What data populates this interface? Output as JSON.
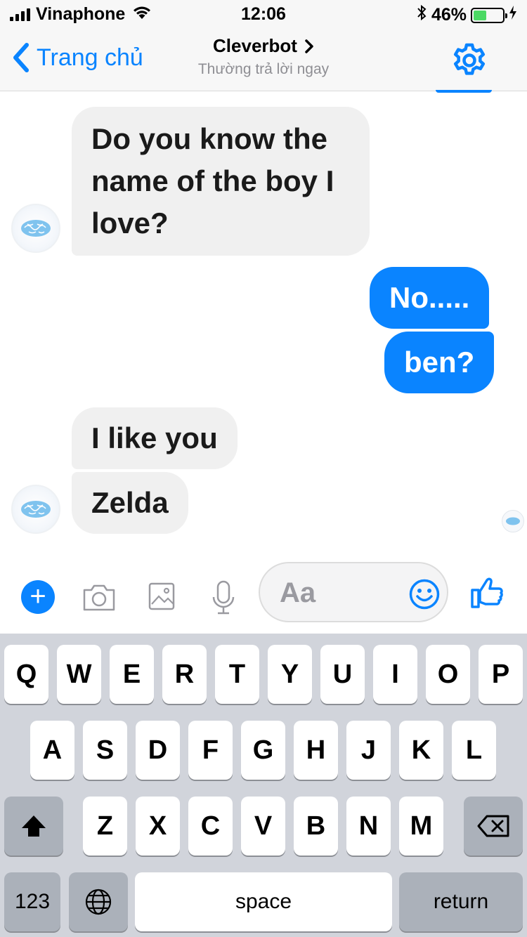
{
  "status_bar": {
    "carrier": "Vinaphone",
    "time": "12:06",
    "battery_percent": "46%",
    "battery_level": 0.46
  },
  "nav": {
    "back_label": "Trang chủ",
    "title": "Cleverbot",
    "subtitle": "Thường trả lời ngay",
    "accent": "#0a84ff"
  },
  "messages": [
    {
      "from": "bot",
      "text": "Do you know the name of the boy I love?"
    },
    {
      "from": "me",
      "text": "No....."
    },
    {
      "from": "me",
      "text": "ben?"
    },
    {
      "from": "bot",
      "text": "I like you"
    },
    {
      "from": "bot",
      "text": "Zelda"
    }
  ],
  "composer": {
    "placeholder": "Aa",
    "icons": [
      "plus-icon",
      "camera-icon",
      "image-icon",
      "microphone-icon",
      "emoji-icon",
      "thumbs-up-icon"
    ]
  },
  "keyboard": {
    "row1": [
      "Q",
      "W",
      "E",
      "R",
      "T",
      "Y",
      "U",
      "I",
      "O",
      "P"
    ],
    "row2": [
      "A",
      "S",
      "D",
      "F",
      "G",
      "H",
      "J",
      "K",
      "L"
    ],
    "row3": [
      "Z",
      "X",
      "C",
      "V",
      "B",
      "N",
      "M"
    ],
    "numbers_label": "123",
    "space_label": "space",
    "return_label": "return"
  }
}
